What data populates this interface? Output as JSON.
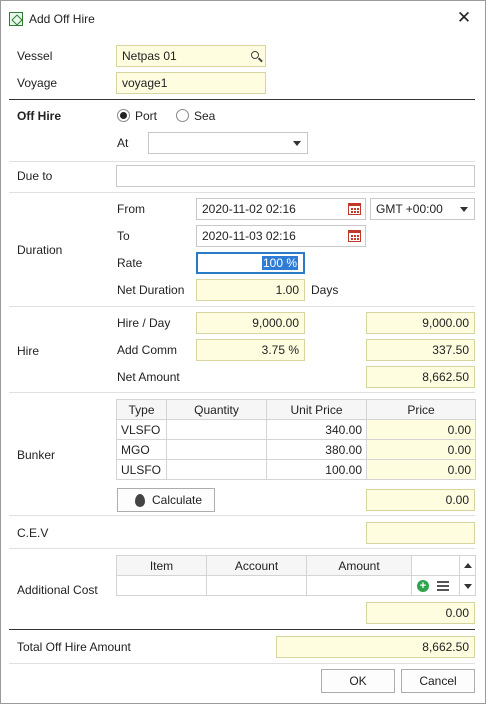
{
  "window": {
    "title": "Add Off Hire",
    "close": "✕"
  },
  "vessel": {
    "label": "Vessel",
    "value": "Netpas 01"
  },
  "voyage": {
    "label": "Voyage",
    "value": "voyage1"
  },
  "off_hire": {
    "label": "Off Hire",
    "port_label": "Port",
    "sea_label": "Sea",
    "selected": "Port",
    "at_label": "At",
    "at_value": ""
  },
  "due_to": {
    "label": "Due to",
    "value": ""
  },
  "duration": {
    "label": "Duration",
    "from_label": "From",
    "from_value": "2020-11-02 02:16",
    "timezone": "GMT +00:00",
    "to_label": "To",
    "to_value": "2020-11-03 02:16",
    "rate_label": "Rate",
    "rate_value": "100 %",
    "net_label": "Net Duration",
    "net_value": "1.00",
    "net_unit": "Days"
  },
  "hire": {
    "label": "Hire",
    "per_day_label": "Hire / Day",
    "per_day_value": "9,000.00",
    "per_day_total": "9,000.00",
    "comm_label": "Add Comm",
    "comm_value": "3.75 %",
    "comm_total": "337.50",
    "net_label": "Net Amount",
    "net_total": "8,662.50"
  },
  "bunker": {
    "label": "Bunker",
    "columns": [
      "Type",
      "Quantity",
      "Unit Price",
      "Price"
    ],
    "rows": [
      {
        "type": "VLSFO",
        "quantity": "",
        "unit_price": "340.00",
        "price": "0.00"
      },
      {
        "type": "MGO",
        "quantity": "",
        "unit_price": "380.00",
        "price": "0.00"
      },
      {
        "type": "ULSFO",
        "quantity": "",
        "unit_price": "100.00",
        "price": "0.00"
      }
    ],
    "calculate_label": "Calculate",
    "total": "0.00"
  },
  "cev": {
    "label": "C.E.V",
    "value": ""
  },
  "additional_cost": {
    "label": "Additional Cost",
    "columns": [
      "Item",
      "Account",
      "Amount"
    ],
    "total": "0.00"
  },
  "total_off_hire": {
    "label": "Total Off Hire Amount",
    "value": "8,662.50"
  },
  "buttons": {
    "ok": "OK",
    "cancel": "Cancel"
  }
}
